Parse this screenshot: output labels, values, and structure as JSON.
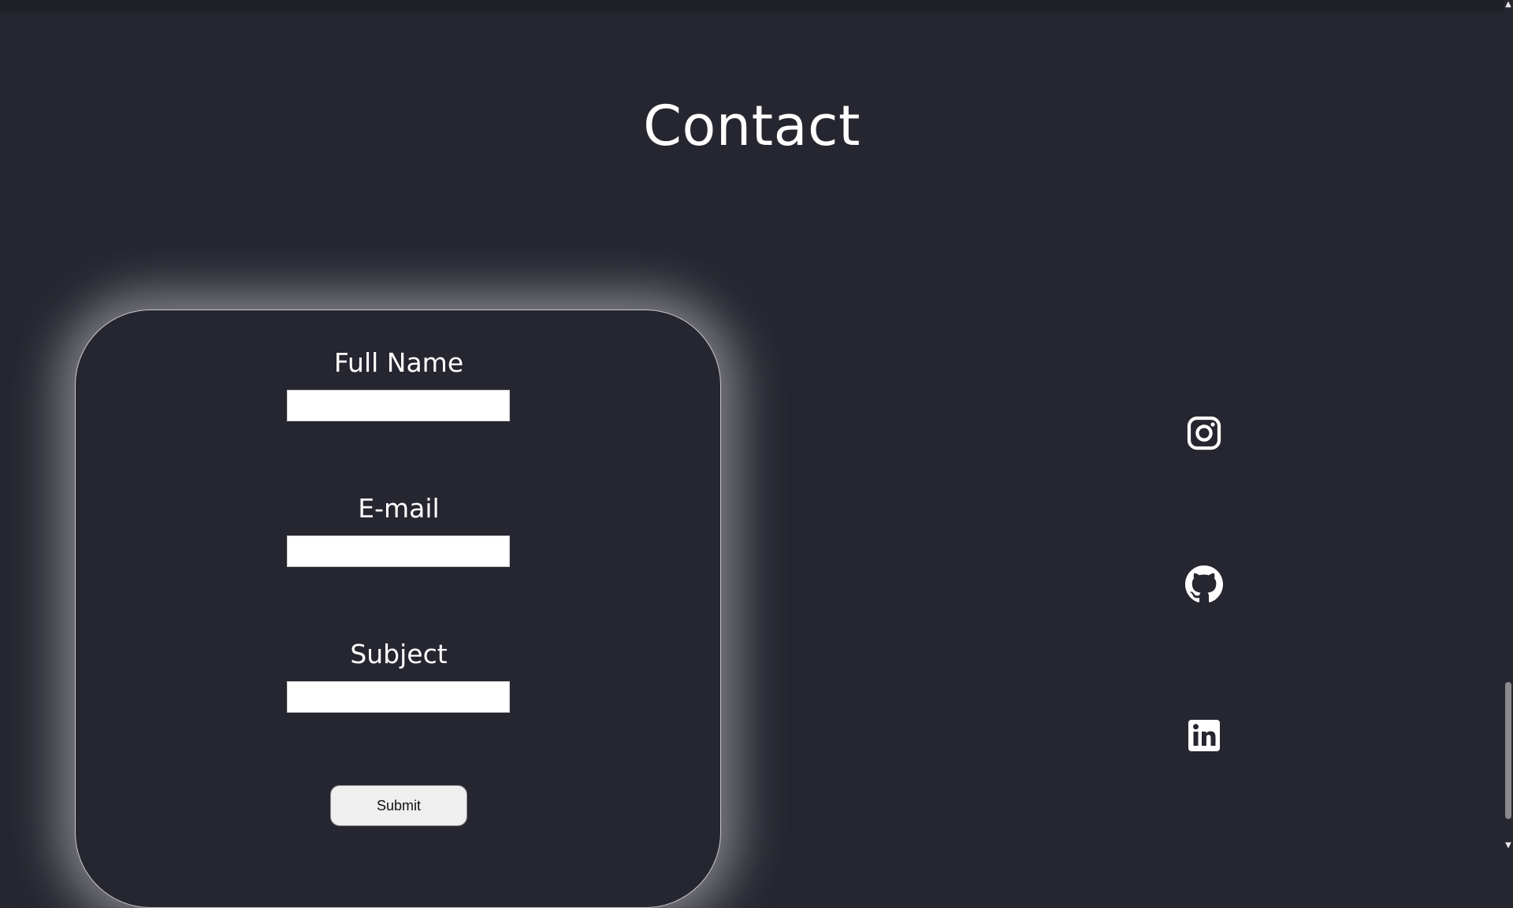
{
  "page": {
    "title": "Contact"
  },
  "form": {
    "fields": [
      {
        "label": "Full Name",
        "value": "",
        "placeholder": ""
      },
      {
        "label": "E-mail",
        "value": "",
        "placeholder": ""
      },
      {
        "label": "Subject",
        "value": "",
        "placeholder": ""
      }
    ],
    "submit_label": "Submit"
  },
  "social": {
    "icons": [
      "instagram-icon",
      "github-icon",
      "linkedin-icon"
    ]
  },
  "colors": {
    "background": "#262630",
    "text": "#ffffff",
    "card_glow": "#c8c8cd",
    "input_background": "#ffffff",
    "button_background": "#efefef"
  },
  "scrollbar": {
    "position_fraction": 0.95
  }
}
